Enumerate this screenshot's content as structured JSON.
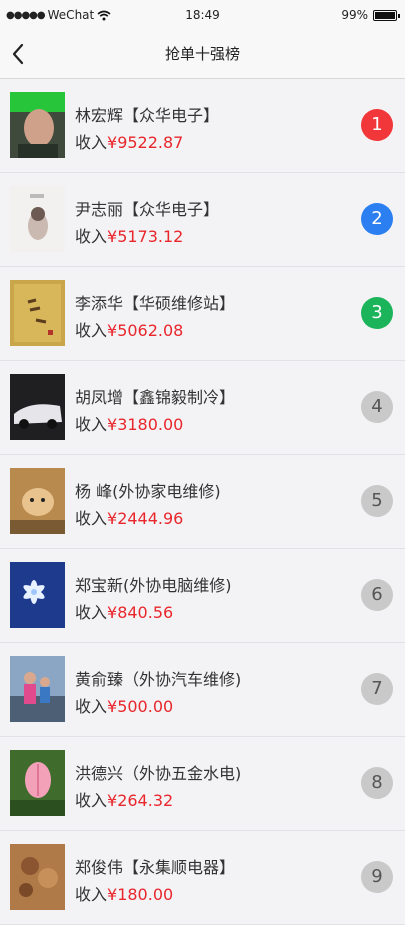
{
  "status_bar": {
    "carrier": "WeChat",
    "time": "18:49",
    "battery": "99%"
  },
  "nav": {
    "title": "抢单十强榜"
  },
  "income_label": "收入",
  "items": [
    {
      "name": "林宏辉【众华电子】",
      "amount": "¥9522.87",
      "rank": "1",
      "rank_color": "#f2373a"
    },
    {
      "name": "尹志丽【众华电子】",
      "amount": "¥5173.12",
      "rank": "2",
      "rank_color": "#2b7ff0"
    },
    {
      "name": "李添华【华硕维修站】",
      "amount": "¥5062.08",
      "rank": "3",
      "rank_color": "#1cb45a"
    },
    {
      "name": "胡凤增【鑫锦毅制冷】",
      "amount": "¥3180.00",
      "rank": "4",
      "rank_color": "#c9c9c9"
    },
    {
      "name": "杨 峰(外协家电维修)",
      "amount": "¥2444.96",
      "rank": "5",
      "rank_color": "#c9c9c9"
    },
    {
      "name": "郑宝新(外协电脑维修)",
      "amount": "¥840.56",
      "rank": "6",
      "rank_color": "#c9c9c9"
    },
    {
      "name": "黄俞臻（外协汽车维修)",
      "amount": "¥500.00",
      "rank": "7",
      "rank_color": "#c9c9c9"
    },
    {
      "name": "洪德兴（外协五金水电)",
      "amount": "¥264.32",
      "rank": "8",
      "rank_color": "#c9c9c9"
    },
    {
      "name": "郑俊伟【永集顺电器】",
      "amount": "¥180.00",
      "rank": "9",
      "rank_color": "#c9c9c9"
    }
  ]
}
